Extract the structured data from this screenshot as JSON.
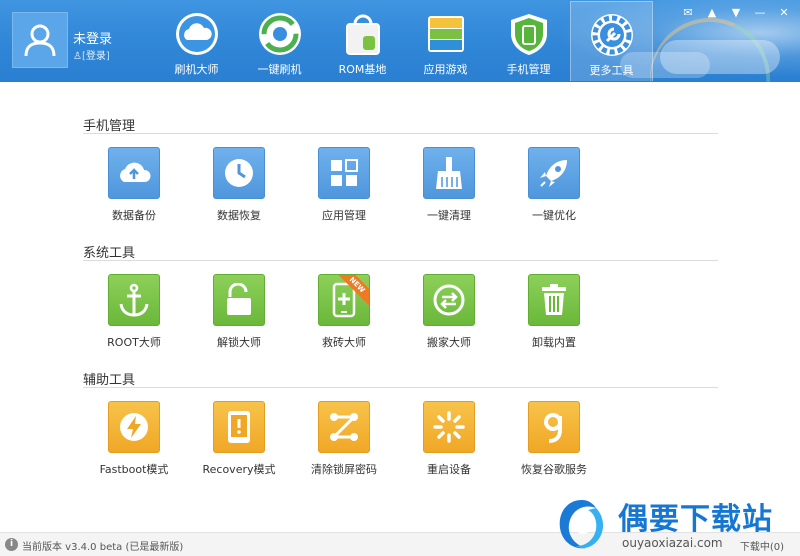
{
  "header": {
    "user": {
      "name": "未登录",
      "login_label": "登录"
    },
    "nav": [
      {
        "label": "刷机大师",
        "icon": "cloud-icon"
      },
      {
        "label": "一键刷机",
        "icon": "refresh-icon"
      },
      {
        "label": "ROM基地",
        "icon": "rom-bag-icon"
      },
      {
        "label": "应用游戏",
        "icon": "app-stack-icon"
      },
      {
        "label": "手机管理",
        "icon": "phone-shield-icon"
      },
      {
        "label": "更多工具",
        "icon": "wrench-gear-icon",
        "active": true
      }
    ]
  },
  "sections": [
    {
      "title": "手机管理",
      "items": [
        {
          "label": "数据备份",
          "icon": "cloud-upload-icon"
        },
        {
          "label": "数据恢复",
          "icon": "clock-icon"
        },
        {
          "label": "应用管理",
          "icon": "grid-icon"
        },
        {
          "label": "一键清理",
          "icon": "broom-icon"
        },
        {
          "label": "一键优化",
          "icon": "rocket-icon"
        }
      ]
    },
    {
      "title": "系统工具",
      "items": [
        {
          "label": "ROOT大师",
          "icon": "anchor-icon"
        },
        {
          "label": "解锁大师",
          "icon": "unlock-icon"
        },
        {
          "label": "救砖大师",
          "icon": "phone-plus-icon",
          "badge": "NEW"
        },
        {
          "label": "搬家大师",
          "icon": "transfer-icon"
        },
        {
          "label": "卸载内置",
          "icon": "trash-icon"
        }
      ]
    },
    {
      "title": "辅助工具",
      "items": [
        {
          "label": "Fastboot模式",
          "icon": "lightning-icon"
        },
        {
          "label": "Recovery模式",
          "icon": "phone-warning-icon"
        },
        {
          "label": "清除锁屏密码",
          "icon": "pattern-lock-icon"
        },
        {
          "label": "重启设备",
          "icon": "restart-icon"
        },
        {
          "label": "恢复谷歌服务",
          "icon": "google-g-icon"
        }
      ]
    }
  ],
  "footer": {
    "version": "当前版本 v3.4.0 beta (已是最新版)",
    "downloads": "下载中(0)"
  },
  "watermark": {
    "title": "偶要下载站",
    "url": "ouyaoxiazai.com"
  }
}
